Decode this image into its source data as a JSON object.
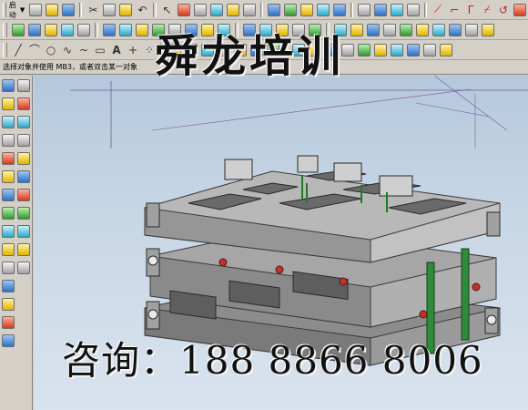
{
  "toolbar": {
    "menu_label": "启动",
    "row1_icons": [
      "start-icon",
      "new-file-icon",
      "open-folder-icon",
      "save-icon",
      "cut-icon",
      "copy-icon",
      "paste-icon",
      "undo-icon",
      "select-icon",
      "edit-object-icon",
      "snap-point-icon",
      "view-fit-icon",
      "shade-icon",
      "wireframe-icon",
      "layer-icon",
      "color-icon",
      "sphere-icon",
      "rotate-view-icon",
      "analysis-icon",
      "curve-icon"
    ],
    "row2_icons": [
      "line-icon",
      "arc-icon",
      "circle-icon",
      "spline-icon",
      "text-icon",
      "point-icon",
      "extrude-icon",
      "revolve-icon",
      "block-icon",
      "cylinder-icon",
      "hole-icon",
      "boss-icon",
      "blend-icon",
      "chamfer-icon"
    ]
  },
  "status": {
    "prompt_text": "选择对象并使用 MB3，或者双击某一对象"
  },
  "watermark": {
    "title": "舜龙培训",
    "contact": "咨询：188 8866 8006"
  },
  "colors": {
    "viewport_top": "#b5c8dc",
    "viewport_bottom": "#d9e3ee",
    "model_gray": "#8e8e8e",
    "guide_pin_green": "#2e8b3a",
    "screw_red": "#c0322a"
  }
}
